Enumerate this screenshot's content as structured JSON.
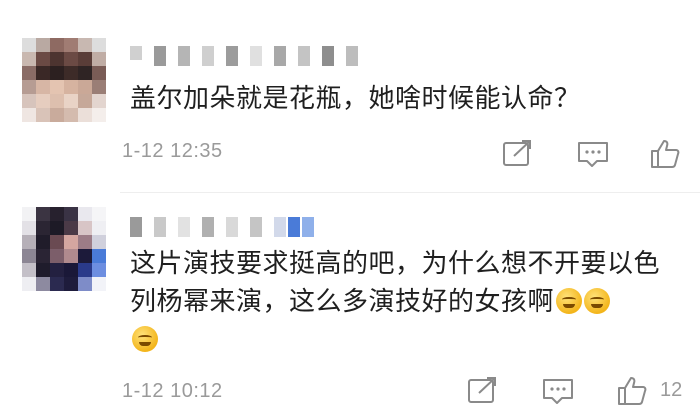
{
  "comments": [
    {
      "text": "盖尔加朵就是花瓶，她啥时候能认命？",
      "time": "1-12 12:35",
      "like_count": ""
    },
    {
      "text": "这片演技要求挺高的吧，为什么想不开要以色列杨幂来演，这么多演技好的女孩啊",
      "time": "1-12 10:12",
      "like_count": "12"
    }
  ],
  "icons": {
    "share": "share-icon",
    "reply": "comment-icon",
    "like": "thumbs-up-icon",
    "emoji": "smirk-emoji"
  },
  "colors": {
    "text": "#1f1f1f",
    "meta": "#9a9a9a",
    "accent_blue": "#4a7bd8"
  }
}
